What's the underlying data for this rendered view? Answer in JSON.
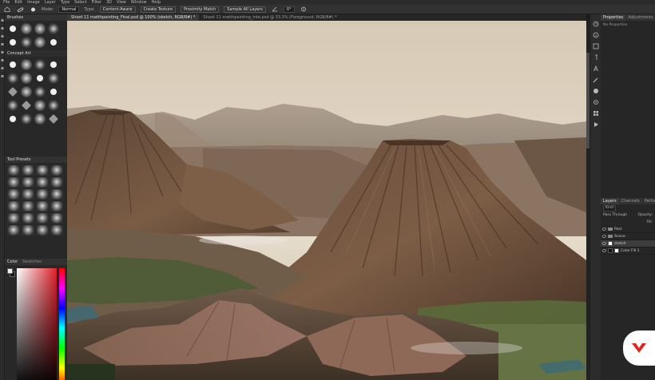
{
  "menubar": {
    "items": [
      "File",
      "Edit",
      "Image",
      "Layer",
      "Type",
      "Select",
      "Filter",
      "3D",
      "View",
      "Window",
      "Help"
    ]
  },
  "options": {
    "mode_label": "Mode:",
    "mode_value": "Normal",
    "type_label": "Type:",
    "content_aware": "Content-Aware",
    "create_texture": "Create Texture",
    "proximity_match": "Proximity Match",
    "sample_all_layers": "Sample All Layers",
    "angle_value": "0°"
  },
  "document_tabs": [
    {
      "label": "Shoot 11 matthpainting_Final.psd @ 100% (sketch, RGB/8#) *",
      "active": true
    },
    {
      "label": "Shoot 11 matthpainting_inte.psd @ 33.3% (Foreground, RGB/8#) *",
      "active": false
    }
  ],
  "brushes": {
    "title": "Brushes",
    "group_name": "Concept Art"
  },
  "presets": {
    "title": "Tool Presets"
  },
  "color": {
    "tab_color": "Color",
    "tab_swatches": "Swatches",
    "foreground": "#f0f0f0",
    "background": "#141414",
    "selected_hue": "#e0202a"
  },
  "properties": {
    "tab_properties": "Properties",
    "tab_adjustments": "Adjustments",
    "empty_text": "No Properties"
  },
  "layers": {
    "tab_layers": "Layers",
    "tab_channels": "Channels",
    "tab_paths": "Paths",
    "kind_label": "Kind",
    "blend_mode": "Pass Through",
    "opacity_label": "Opacity:",
    "fill_label": "Fill:",
    "rows": [
      {
        "name": "Post",
        "kind": "group"
      },
      {
        "name": "Scene",
        "kind": "group"
      },
      {
        "name": "sketch",
        "kind": "layer",
        "selected": true
      },
      {
        "name": "Color Fill 1",
        "kind": "fill"
      }
    ]
  },
  "brand": {
    "accent": "#e2231a"
  }
}
